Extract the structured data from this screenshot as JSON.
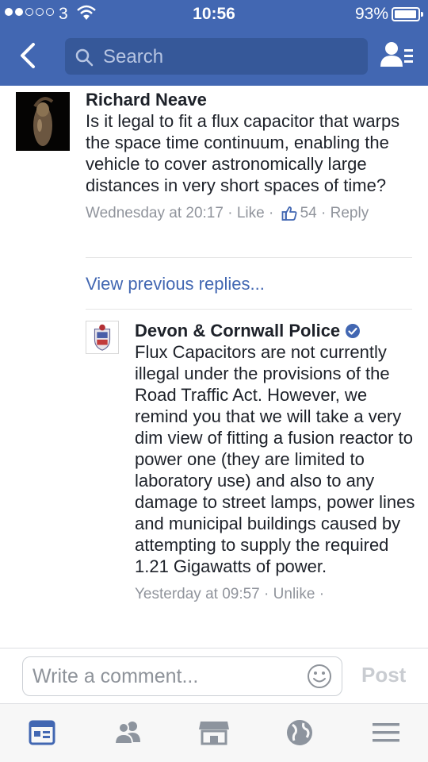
{
  "status": {
    "carrier": "3",
    "time": "10:56",
    "battery": "93%",
    "battery_level": 0.93
  },
  "nav": {
    "search_placeholder": "Search"
  },
  "comment": {
    "author": "Richard Neave",
    "text": "Is it legal to fit a flux capacitor that warps the space time continuum, enabling the vehicle to cover astronomically large distances in very short spaces of time?",
    "time": "Wednesday at 20:17",
    "like_label": "Like",
    "like_count": "54",
    "reply_label": "Reply"
  },
  "view_previous": "View previous replies...",
  "reply": {
    "author": "Devon & Cornwall Police",
    "text": "Flux Capacitors are not currently illegal under the provisions of the Road Traffic Act. However, we remind you that we will take a very dim view of fitting a fusion reactor to power one (they are limited to laboratory use) and also to any damage to street lamps, power lines and municipal buildings caused by attempting to supply the required 1.21 Gigawatts of power.",
    "time": "Yesterday at 09:57",
    "unlike_label": "Unlike"
  },
  "composer": {
    "placeholder": "Write a comment...",
    "post_label": "Post"
  },
  "tabs": [
    {
      "icon": "news-feed-icon",
      "active": true
    },
    {
      "icon": "friends-icon",
      "active": false
    },
    {
      "icon": "marketplace-icon",
      "active": false
    },
    {
      "icon": "globe-icon",
      "active": false
    },
    {
      "icon": "menu-icon",
      "active": false
    }
  ],
  "colors": {
    "brand": "#4267b2",
    "link": "#4267b2",
    "meta": "#90949c",
    "text": "#1d2129"
  }
}
